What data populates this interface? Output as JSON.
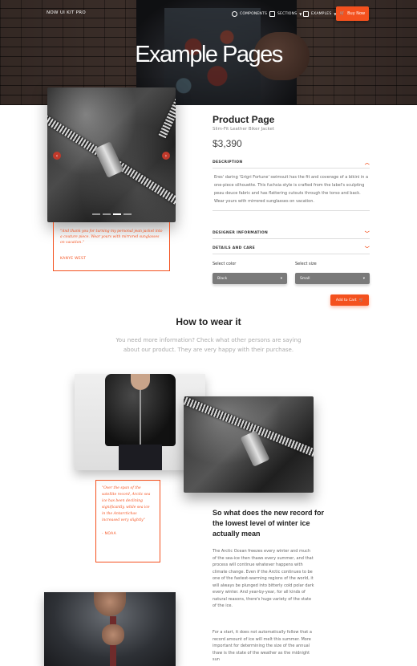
{
  "nav": {
    "brand": "Now UI Kit Pro",
    "items": [
      {
        "label": "Components",
        "icon": "components-icon"
      },
      {
        "label": "Sections",
        "icon": "sections-icon"
      },
      {
        "label": "Examples",
        "icon": "examples-icon"
      }
    ],
    "buy_label": "Buy Now"
  },
  "hero": {
    "title": "Example Pages"
  },
  "product": {
    "title": "Product Page",
    "subtitle": "Slim-Fit Leather Biker Jacket",
    "price": "$3,390",
    "quote": {
      "text": "\"And thank you for turning my personal jean jacket into a couture piece. Wear yours with mirrored sunglasses on vacation.\"",
      "author": "Kanye West"
    },
    "accordion": [
      {
        "title": "Description",
        "open": true,
        "body": "Eres' daring 'Grigri Fortune' swimsuit has the fit and coverage of a bikini in a one-piece silhouette. This fuchsia style is crafted from the label's sculpting peau douce fabric and has flattering cutouts through the torso and back. Wear yours with mirrored sunglasses on vacation."
      },
      {
        "title": "Designer Information",
        "open": false
      },
      {
        "title": "Details and Care",
        "open": false
      }
    ],
    "color": {
      "label": "Select color",
      "value": "Black"
    },
    "size": {
      "label": "Select size",
      "value": "Small"
    },
    "cart_label": "Add to Cart"
  },
  "wear": {
    "title": "How to wear it",
    "description": "You need more information? Check what other persons are saying about our product. They are very happy with their purchase.",
    "quote": {
      "text": "\"Over the span of the satellite record, Arctic sea ice has been declining significantly, while sea ice in the Antarctichas increased very slightly\"",
      "author": "- NOAA"
    },
    "article_title": "So what does the new record for the lowest level of winter ice actually mean",
    "paragraphs": [
      "The Arctic Ocean freezes every winter and much of the sea-ice then thaws every summer, and that process will continue whatever happens with climate change. Even if the Arctic continues to be one of the fastest-warming regions of the world, it will always be plunged into bitterly cold polar dark every winter. And year-by-year, for all kinds of natural reasons, there's huge variety of the state of the ice.",
      "For a start, it does not automatically follow that a record amount of ice will melt this summer. More important for determining the size of the annual thaw is the state of the weather as the midnight sun"
    ]
  },
  "colors": {
    "accent": "#f4511e",
    "select_bg": "#7a7a7a"
  }
}
